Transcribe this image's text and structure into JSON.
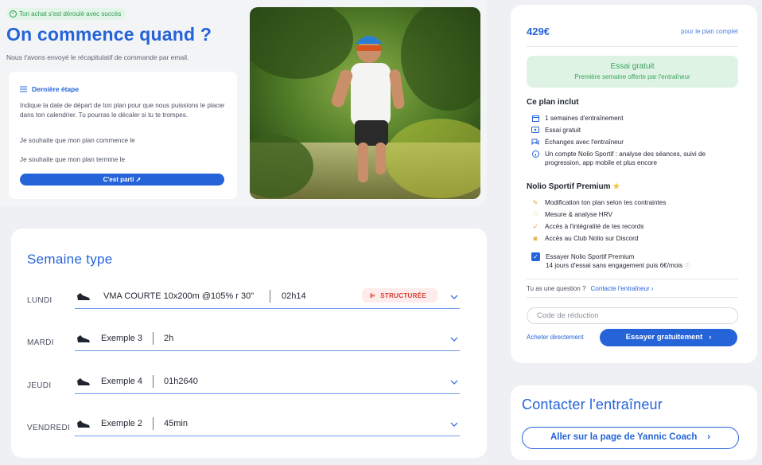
{
  "header": {
    "success_badge": "Ton achat s'est déroulé avec succès",
    "title": "On commence quand ?",
    "subtitle": "Nous t'avons envoyé le récapitulatif de commande par email."
  },
  "last_step": {
    "title": "Dernière étape",
    "description": "Indique la date de départ de ton plan pour que nous puissions le placer dans ton calendrier. Tu pourras le décaler si tu te trompes.",
    "start_label": "Je souhaite que mon plan commence le",
    "end_label": "Je souhaite que mon plan termine le",
    "button": "C'est parti"
  },
  "week": {
    "title": "Semaine type",
    "rows": [
      {
        "day": "LUNDI",
        "name": "VMA COURTE 10x200m @105% r 30\"",
        "duration": "02h14",
        "tag": "STRUCTURÉE"
      },
      {
        "day": "MARDI",
        "name": "Exemple 3",
        "duration": "2h"
      },
      {
        "day": "JEUDI",
        "name": "Exemple 4",
        "duration": "01h2640"
      },
      {
        "day": "VENDREDI",
        "name": "Exemple 2",
        "duration": "45min"
      }
    ]
  },
  "plan": {
    "price": "429€",
    "price_note": "pour le plan complet",
    "trial_title": "Essai gratuit",
    "trial_sub": "Première semaine offerte par l'entraîneur",
    "includes_title": "Ce plan inclut",
    "includes": [
      {
        "icon": "calendar-icon",
        "text": "1 semaines d'entraînement"
      },
      {
        "icon": "ticket-icon",
        "text": "Essai gratuit"
      },
      {
        "icon": "chat-icon",
        "text": "Échanges avec l'entraîneur"
      },
      {
        "icon": "info-icon",
        "text": "Un compte Nolio Sportif : analyse des séances, suivi de progression, app mobile et plus encore"
      }
    ],
    "premium_title": "Nolio Sportif Premium",
    "premium": [
      {
        "icon": "edit-icon",
        "text": "Modification ton plan selon tes contraintes"
      },
      {
        "icon": "heart-icon",
        "text": "Mesure & analyse HRV"
      },
      {
        "icon": "rocket-icon",
        "text": "Accès à l'intégralité de tes records"
      },
      {
        "icon": "discord-icon",
        "text": "Accès au Club Nolio sur Discord"
      }
    ],
    "premium_option_title": "Essayer Nolio Sportif Premium",
    "premium_option_sub": "14 jours d'essai sans engagement puis 6€/mois",
    "question": "Tu as une question ?",
    "contact_link": "Contacte l'entraîneur",
    "promo_placeholder": "Code de réduction",
    "buy_direct": "Acheter directement",
    "try_button": "Essayer gratuitement"
  },
  "contact": {
    "title": "Contacter l'entraîneur",
    "button": "Aller sur la page de Yannic Coach"
  },
  "colors": {
    "accent": "#2563d9",
    "success": "#38a55c",
    "tag_red": "#d83a2e"
  }
}
